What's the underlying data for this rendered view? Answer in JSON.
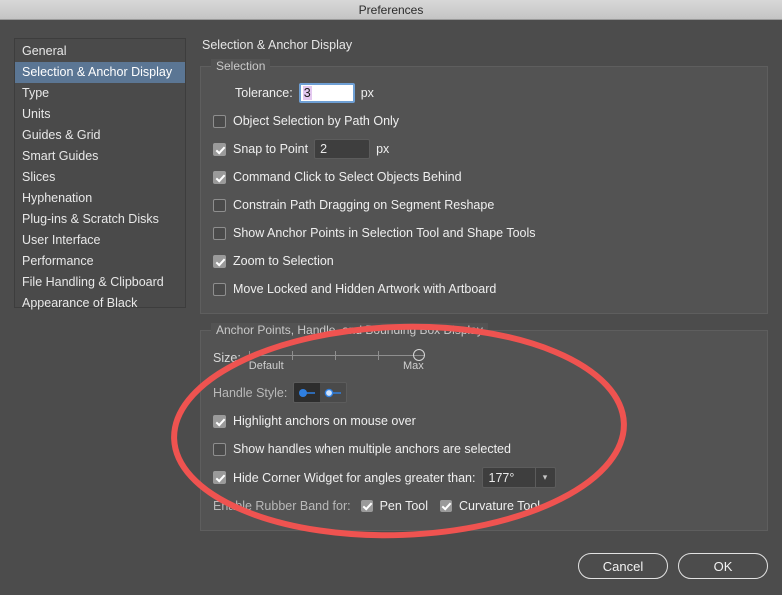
{
  "window": {
    "title": "Preferences"
  },
  "sidebar": {
    "items": [
      {
        "label": "General",
        "selected": false
      },
      {
        "label": "Selection & Anchor Display",
        "selected": true
      },
      {
        "label": "Type",
        "selected": false
      },
      {
        "label": "Units",
        "selected": false
      },
      {
        "label": "Guides & Grid",
        "selected": false
      },
      {
        "label": "Smart Guides",
        "selected": false
      },
      {
        "label": "Slices",
        "selected": false
      },
      {
        "label": "Hyphenation",
        "selected": false
      },
      {
        "label": "Plug-ins & Scratch Disks",
        "selected": false
      },
      {
        "label": "User Interface",
        "selected": false
      },
      {
        "label": "Performance",
        "selected": false
      },
      {
        "label": "File Handling & Clipboard",
        "selected": false
      },
      {
        "label": "Appearance of Black",
        "selected": false
      }
    ]
  },
  "panel": {
    "title": "Selection & Anchor Display",
    "selection_group": {
      "legend": "Selection",
      "tolerance": {
        "label": "Tolerance:",
        "value": "3",
        "unit": "px"
      },
      "object_selection_by_path_only": {
        "label": "Object Selection by Path Only",
        "checked": false
      },
      "snap_to_point": {
        "label": "Snap to Point",
        "value": "2",
        "unit": "px",
        "checked": true
      },
      "command_click": {
        "label": "Command Click to Select Objects Behind",
        "checked": true
      },
      "constrain_path": {
        "label": "Constrain Path Dragging on Segment Reshape",
        "checked": false
      },
      "show_anchor_points": {
        "label": "Show Anchor Points in Selection Tool and Shape Tools",
        "checked": false
      },
      "zoom_to_selection": {
        "label": "Zoom to Selection",
        "checked": true
      },
      "move_locked": {
        "label": "Move Locked and Hidden Artwork with Artboard",
        "checked": false
      }
    },
    "anchor_group": {
      "legend": "Anchor Points, Handle, and Bounding Box Display",
      "size": {
        "label": "Size:",
        "min_label": "Default",
        "max_label": "Max",
        "position": "max",
        "ticks": 5
      },
      "handle_style": {
        "label": "Handle Style:",
        "selected_index": 0,
        "options": [
          "solid-handle-icon",
          "hollow-handle-icon"
        ]
      },
      "highlight_anchors": {
        "label": "Highlight anchors on mouse over",
        "checked": true
      },
      "show_handles": {
        "label": "Show handles when multiple anchors are selected",
        "checked": false
      },
      "hide_corner_widget": {
        "label": "Hide Corner Widget for angles greater than:",
        "checked": true,
        "angle_value": "177°"
      },
      "rubber_band": {
        "label": "Enable Rubber Band for:",
        "pen_tool": {
          "label": "Pen Tool",
          "checked": true
        },
        "curvature_tool": {
          "label": "Curvature Tool",
          "checked": true
        }
      }
    }
  },
  "footer": {
    "cancel_label": "Cancel",
    "ok_label": "OK"
  },
  "annotation": {
    "shape": "ellipse-highlight",
    "color": "#ef5350"
  }
}
